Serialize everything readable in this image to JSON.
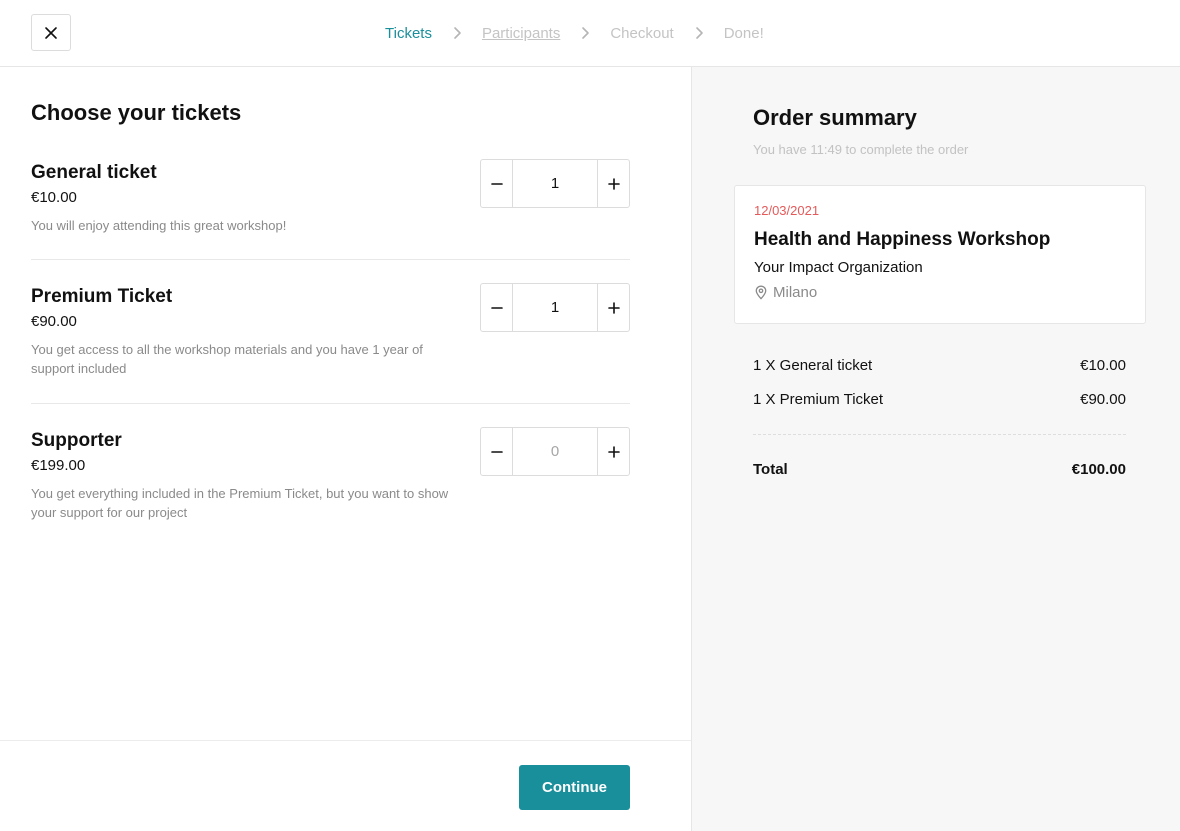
{
  "header": {
    "steps": [
      {
        "label": "Tickets"
      },
      {
        "label": "Participants"
      },
      {
        "label": "Checkout"
      },
      {
        "label": "Done!"
      }
    ]
  },
  "tickets": {
    "title": "Choose your tickets",
    "items": [
      {
        "name": "General ticket",
        "price": "€10.00",
        "description": "You will enjoy attending this great workshop!",
        "quantity": "1"
      },
      {
        "name": "Premium Ticket",
        "price": "€90.00",
        "description": "You get access to all the workshop materials and you have 1 year of support included",
        "quantity": "1"
      },
      {
        "name": "Supporter",
        "price": "€199.00",
        "description": "You get everything included in the Premium Ticket, but you want to show your support for our project",
        "quantity": "0"
      }
    ],
    "continue_label": "Continue"
  },
  "summary": {
    "title": "Order summary",
    "timer": "You have 11:49 to complete the order",
    "event": {
      "date": "12/03/2021",
      "name": "Health and Happiness Workshop",
      "organization": "Your Impact Organization",
      "location": "Milano"
    },
    "lines": [
      {
        "label": "1 X General ticket",
        "amount": "€10.00"
      },
      {
        "label": "1 X Premium Ticket",
        "amount": "€90.00"
      }
    ],
    "total_label": "Total",
    "total_amount": "€100.00"
  },
  "colors": {
    "accent": "#1a8f9c",
    "date": "#e45a5a"
  },
  "icons": [
    "close-icon",
    "chevron-right-icon",
    "minus-icon",
    "plus-icon",
    "location-pin-icon"
  ]
}
